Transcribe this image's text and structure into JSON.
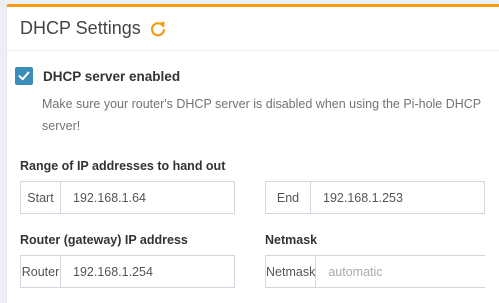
{
  "panel": {
    "title": "DHCP Settings",
    "accent_color": "#f39c12",
    "refresh_icon": "refresh-icon"
  },
  "dhcp_enabled": {
    "checked": true,
    "label": "DHCP server enabled",
    "help": "Make sure your router's DHCP server is disabled when using the Pi-hole DHCP server!"
  },
  "range": {
    "label": "Range of IP addresses to hand out",
    "start": {
      "addon": "Start",
      "value": "192.168.1.64"
    },
    "end": {
      "addon": "End",
      "value": "192.168.1.253"
    }
  },
  "router": {
    "label": "Router (gateway) IP address",
    "addon": "Router",
    "value": "192.168.1.254"
  },
  "netmask": {
    "label": "Netmask",
    "addon": "Netmask",
    "placeholder": "automatic",
    "value": ""
  }
}
